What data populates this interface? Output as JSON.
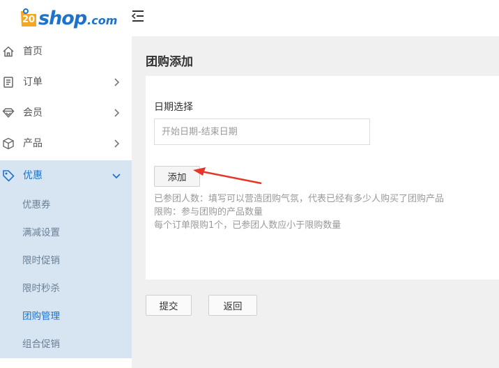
{
  "header": {
    "logo_number": "20",
    "logo_name": "shop",
    "logo_suffix": ".com",
    "brand_color": "#1d72c9",
    "logo_accent_color": "#f5a623"
  },
  "sidebar": {
    "items": [
      {
        "label": "首页",
        "icon": "home-icon",
        "has_chevron": false
      },
      {
        "label": "订单",
        "icon": "order-list-icon",
        "has_chevron": true
      },
      {
        "label": "会员",
        "icon": "diamond-icon",
        "has_chevron": true
      },
      {
        "label": "产品",
        "icon": "box-icon",
        "has_chevron": true
      },
      {
        "label": "优惠",
        "icon": "tag-icon",
        "has_chevron": true,
        "expanded": true
      }
    ],
    "subitems": [
      {
        "label": "优惠券"
      },
      {
        "label": "满减设置"
      },
      {
        "label": "限时促销"
      },
      {
        "label": "限时秒杀"
      },
      {
        "label": "团购管理",
        "current": true
      },
      {
        "label": "组合促销"
      }
    ]
  },
  "main": {
    "title": "团购添加",
    "date_label": "日期选择",
    "date_placeholder": "开始日期-结束日期",
    "date_value": "",
    "add_button": "添加",
    "hints": [
      "已参团人数：填写可以营造团购气氛，代表已经有多少人购买了团购产品",
      "限购：参与团购的产品数量",
      "每个订单限购1个，已参团人数应小于限购数量"
    ],
    "submit_button": "提交",
    "back_button": "返回",
    "annotation_arrow_color": "#e8352a"
  }
}
